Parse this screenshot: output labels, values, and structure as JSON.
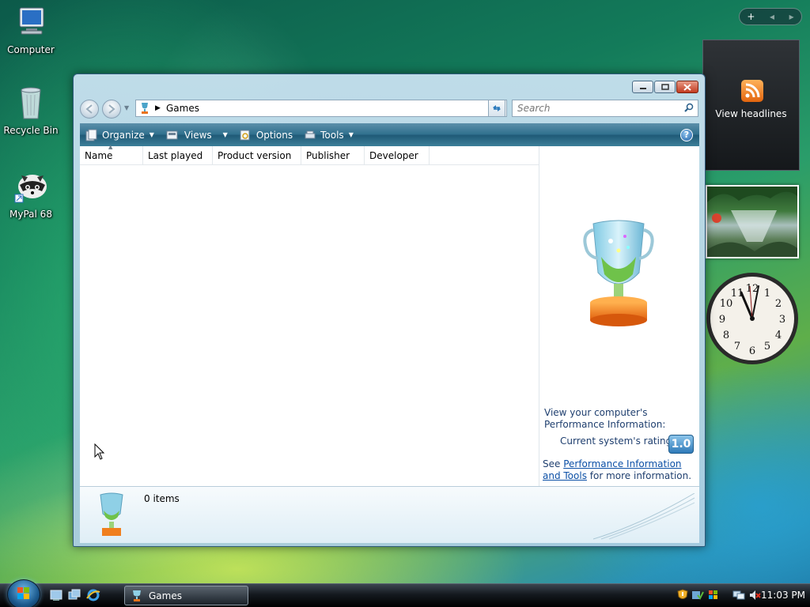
{
  "desktop": {
    "icons": [
      {
        "label": "Computer",
        "icon": "computer-icon"
      },
      {
        "label": "Recycle Bin",
        "icon": "recycle-bin-icon"
      },
      {
        "label": "MyPal 68",
        "icon": "mypal-icon"
      }
    ]
  },
  "window": {
    "address": {
      "label": "Games"
    },
    "search": {
      "placeholder": "Search"
    },
    "toolbar": {
      "organize": "Organize",
      "views": "Views",
      "options": "Options",
      "tools": "Tools"
    },
    "columns": [
      "Name",
      "Last played",
      "Product version",
      "Publisher",
      "Developer"
    ],
    "preview": {
      "perf_text": "View your computer's Performance Information:",
      "rating_label": "Current system's rating:",
      "rating_value": "1.0",
      "see_prefix": "See ",
      "see_link": "Performance Information and Tools",
      "see_suffix": " for more information."
    },
    "details": {
      "count": "0 items"
    }
  },
  "gadgets": {
    "feed_label": "View headlines"
  },
  "taskbar": {
    "task_label": "Games",
    "time": "11:03 PM"
  },
  "colors": {
    "toolbar": "#2f6f8d",
    "link": "#0b4fa6",
    "rating": "#2f7ab8"
  }
}
